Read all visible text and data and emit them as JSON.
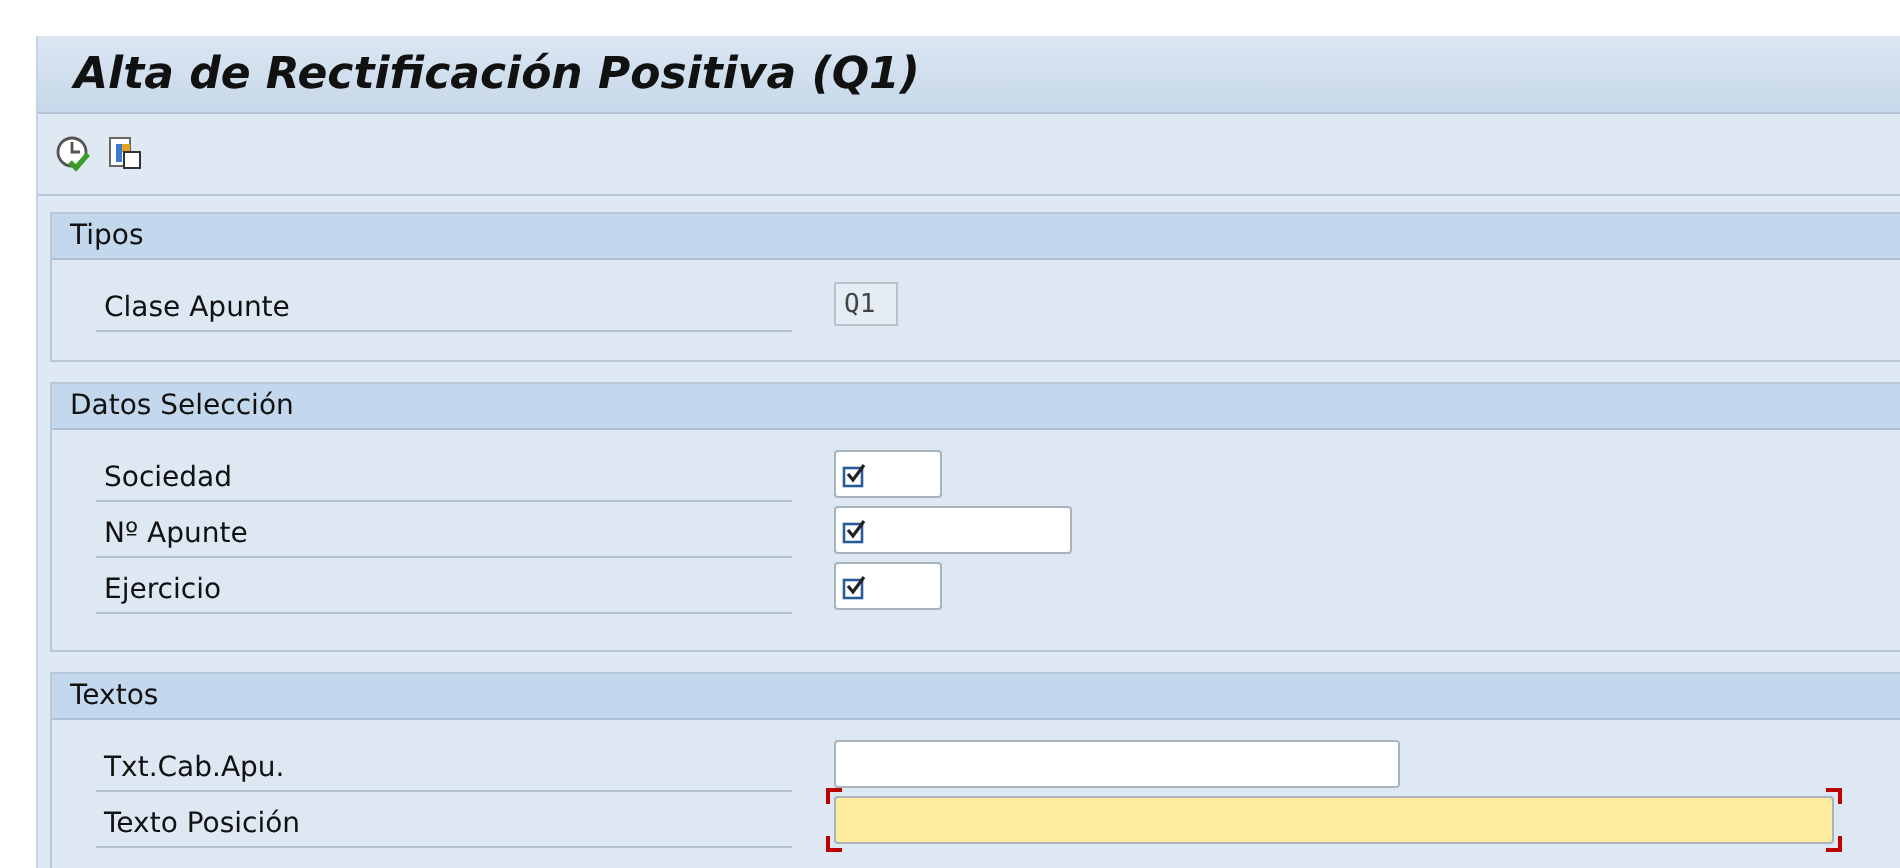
{
  "window": {
    "title": "Alta de Rectificación Positiva (Q1)"
  },
  "sections": [
    {
      "title": "Tipos",
      "fields": [
        {
          "label": "Clase Apunte",
          "kind": "display",
          "value": "Q1"
        }
      ]
    },
    {
      "title": "Datos Selección",
      "fields": [
        {
          "label": "Sociedad",
          "kind": "select",
          "focused": false
        },
        {
          "label": "Nº Apunte",
          "kind": "select",
          "focused": false
        },
        {
          "label": "Ejercicio",
          "kind": "select",
          "focused": false
        }
      ]
    },
    {
      "title": "Textos",
      "fields": [
        {
          "label": "Txt.Cab.Apu.",
          "kind": "text",
          "focused": false
        },
        {
          "label": "Texto Posición",
          "kind": "text",
          "focused": true
        }
      ]
    }
  ]
}
